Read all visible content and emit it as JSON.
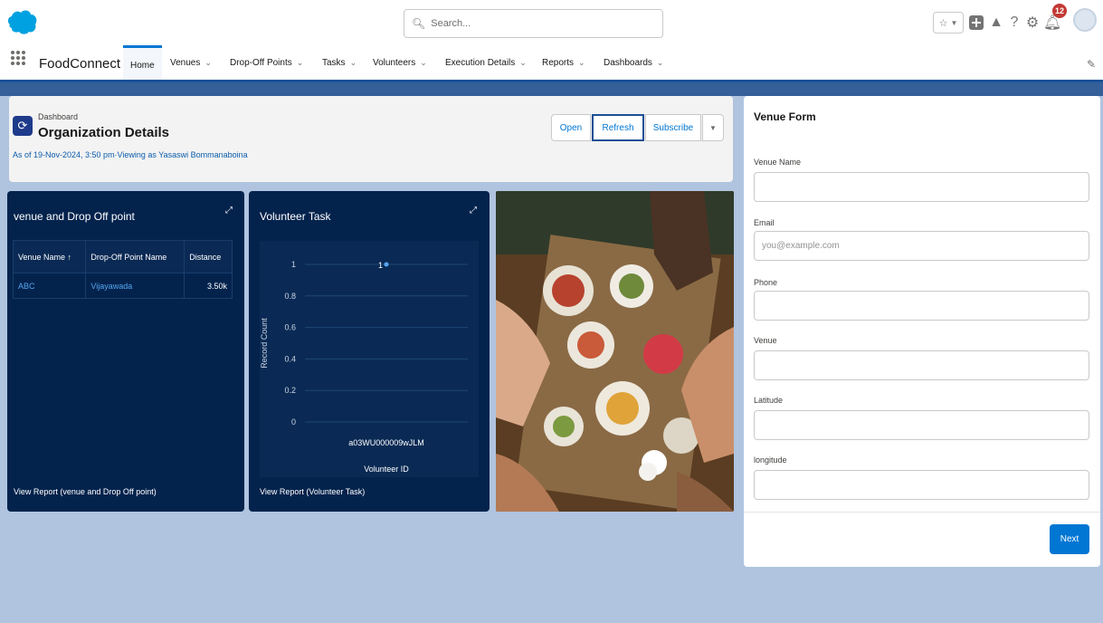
{
  "search": {
    "placeholder": "Search..."
  },
  "header": {
    "app_name": "FoodConnect",
    "notification_count": "12",
    "nav": [
      {
        "label": "Home",
        "active": true
      },
      {
        "label": "Venues"
      },
      {
        "label": "Drop-Off Points"
      },
      {
        "label": "Tasks"
      },
      {
        "label": "Volunteers"
      },
      {
        "label": "Execution Details"
      },
      {
        "label": "Reports"
      },
      {
        "label": "Dashboards"
      }
    ]
  },
  "dashboard": {
    "label": "Dashboard",
    "title": "Organization Details",
    "subtitle": "As of 19-Nov-2024, 3:50 pm·Viewing as Yasaswi Bommanaboina",
    "buttons": {
      "open": "Open",
      "refresh": "Refresh",
      "subscribe": "Subscribe"
    }
  },
  "venue_card": {
    "title": "venue and Drop Off point",
    "columns": [
      "Venue Name ↑",
      "Drop-Off Point Name",
      "Distance"
    ],
    "rows": [
      [
        "ABC",
        "Vijayawada",
        "3.50k"
      ]
    ],
    "link": "View Report (venue and Drop Off point)"
  },
  "volunteer_card": {
    "title": "Volunteer Task",
    "link": "View Report (Volunteer Task)"
  },
  "chart_data": {
    "type": "scatter",
    "title": "Volunteer Task",
    "xlabel": "Volunteer ID",
    "ylabel": "Record Count",
    "categories": [
      "a03WU000009wJLM"
    ],
    "values": [
      1
    ],
    "data_labels": [
      "1"
    ],
    "yticks": [
      "0",
      "0.2",
      "0.4",
      "0.6",
      "0.8",
      "1"
    ],
    "ylim": [
      0,
      1
    ],
    "grid": true,
    "color": "#57a5f0"
  },
  "venue_form": {
    "title": "Venue Form",
    "fields": [
      {
        "label": "Venue Name",
        "value": "",
        "placeholder": ""
      },
      {
        "label": "Email",
        "value": "",
        "placeholder": "you@example.com"
      },
      {
        "label": "Phone",
        "value": "",
        "placeholder": ""
      },
      {
        "label": "Venue",
        "value": "",
        "placeholder": ""
      },
      {
        "label": "Latitude",
        "value": "",
        "placeholder": ""
      },
      {
        "label": "longitude",
        "value": "",
        "placeholder": ""
      }
    ],
    "next_label": "Next"
  },
  "colors": {
    "brand": "#0176d3",
    "card_bg": "#03234d",
    "page_bg": "#b0c4df"
  }
}
